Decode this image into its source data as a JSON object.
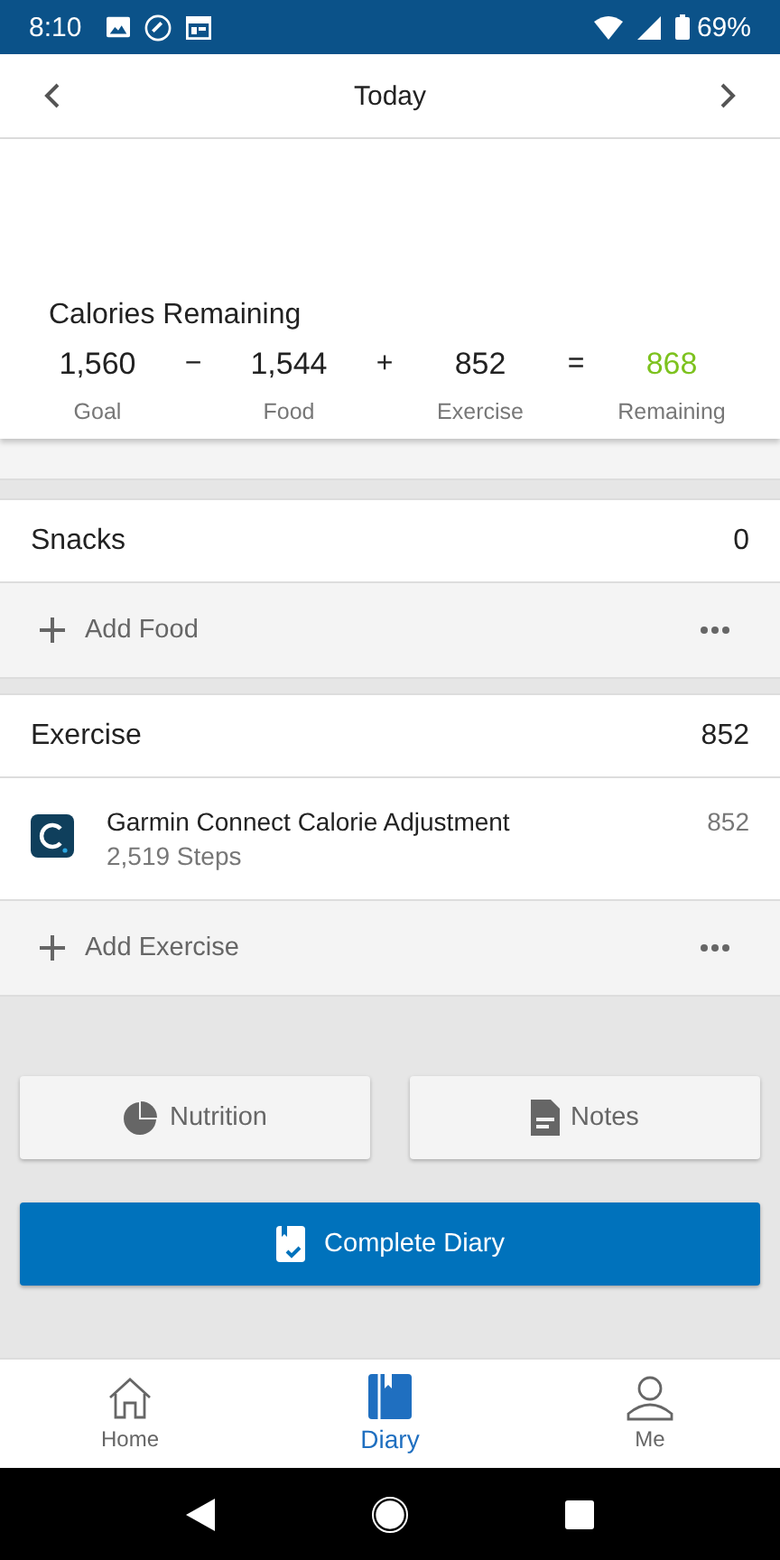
{
  "status_bar": {
    "time": "8:10",
    "battery": "69%"
  },
  "header": {
    "title": "Today"
  },
  "summary": {
    "title": "Calories Remaining",
    "items": [
      {
        "value": "1,560",
        "label": "Goal",
        "operator": "−",
        "kind": "plain"
      },
      {
        "value": "1,544",
        "label": "Food",
        "operator": "+",
        "kind": "plain"
      },
      {
        "value": "852",
        "label": "Exercise",
        "operator": "=",
        "kind": "plain"
      },
      {
        "value": "868",
        "label": "Remaining",
        "kind": "result"
      }
    ]
  },
  "sections": [
    {
      "title": "Snacks",
      "total": "0",
      "add_label": "Add Food"
    },
    {
      "title": "Exercise",
      "total": "852",
      "entries": [
        {
          "name": "Garmin Connect Calorie Adjustment",
          "detail": "2,519 Steps",
          "calories": "852"
        }
      ],
      "add_label": "Add Exercise"
    }
  ],
  "buttons": [
    {
      "label": "Nutrition",
      "kind": "nutrition"
    },
    {
      "label": "Notes",
      "kind": "notes"
    }
  ],
  "primary_button": {
    "label": "Complete Diary"
  },
  "bottom_nav": [
    {
      "label": "Home",
      "kind": "home",
      "selected": false
    },
    {
      "label": "Diary",
      "kind": "diary",
      "selected": true
    },
    {
      "label": "Me",
      "kind": "me",
      "selected": false
    }
  ]
}
